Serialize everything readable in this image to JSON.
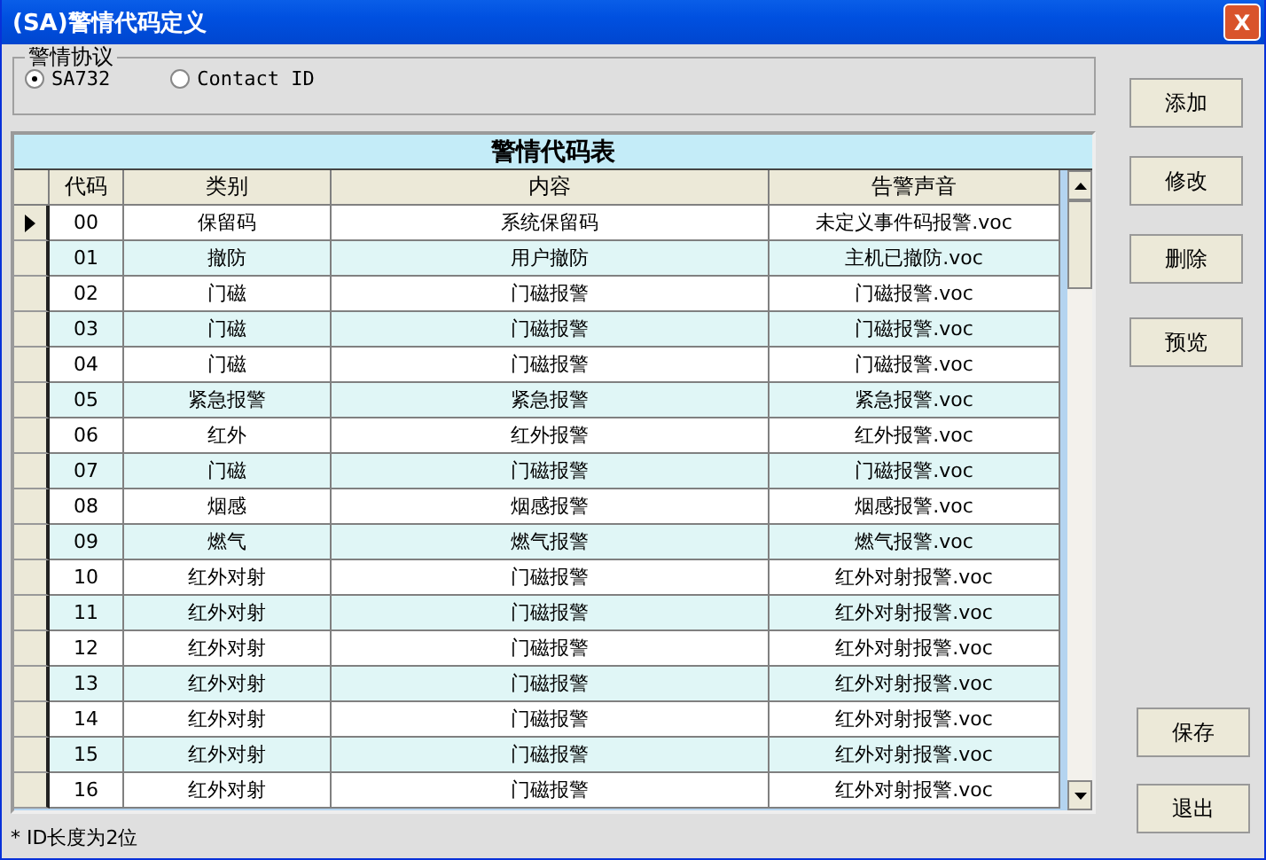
{
  "window": {
    "title": "(SA)警情代码定义",
    "close": "X"
  },
  "protocol": {
    "label": "警情协议",
    "options": [
      {
        "label": "SA732",
        "selected": true
      },
      {
        "label": "Contact ID",
        "selected": false
      }
    ]
  },
  "table": {
    "title": "警情代码表",
    "columns": [
      "代码",
      "类别",
      "内容",
      "告警声音"
    ],
    "rows": [
      {
        "code": "00",
        "category": "保留码",
        "content": "系统保留码",
        "sound": "未定义事件码报警.voc",
        "selected": true
      },
      {
        "code": "01",
        "category": "撤防",
        "content": "用户撤防",
        "sound": "主机已撤防.voc",
        "selected": false
      },
      {
        "code": "02",
        "category": "门磁",
        "content": "门磁报警",
        "sound": "门磁报警.voc",
        "selected": false
      },
      {
        "code": "03",
        "category": "门磁",
        "content": "门磁报警",
        "sound": "门磁报警.voc",
        "selected": false
      },
      {
        "code": "04",
        "category": "门磁",
        "content": "门磁报警",
        "sound": "门磁报警.voc",
        "selected": false
      },
      {
        "code": "05",
        "category": "紧急报警",
        "content": "紧急报警",
        "sound": "紧急报警.voc",
        "selected": false
      },
      {
        "code": "06",
        "category": "红外",
        "content": "红外报警",
        "sound": "红外报警.voc",
        "selected": false
      },
      {
        "code": "07",
        "category": "门磁",
        "content": "门磁报警",
        "sound": "门磁报警.voc",
        "selected": false
      },
      {
        "code": "08",
        "category": "烟感",
        "content": "烟感报警",
        "sound": "烟感报警.voc",
        "selected": false
      },
      {
        "code": "09",
        "category": "燃气",
        "content": "燃气报警",
        "sound": "燃气报警.voc",
        "selected": false
      },
      {
        "code": "10",
        "category": "红外对射",
        "content": "门磁报警",
        "sound": "红外对射报警.voc",
        "selected": false
      },
      {
        "code": "11",
        "category": "红外对射",
        "content": "门磁报警",
        "sound": "红外对射报警.voc",
        "selected": false
      },
      {
        "code": "12",
        "category": "红外对射",
        "content": "门磁报警",
        "sound": "红外对射报警.voc",
        "selected": false
      },
      {
        "code": "13",
        "category": "红外对射",
        "content": "门磁报警",
        "sound": "红外对射报警.voc",
        "selected": false
      },
      {
        "code": "14",
        "category": "红外对射",
        "content": "门磁报警",
        "sound": "红外对射报警.voc",
        "selected": false
      },
      {
        "code": "15",
        "category": "红外对射",
        "content": "门磁报警",
        "sound": "红外对射报警.voc",
        "selected": false
      },
      {
        "code": "16",
        "category": "红外对射",
        "content": "门磁报警",
        "sound": "红外对射报警.voc",
        "selected": false
      }
    ]
  },
  "actions": [
    "添加",
    "修改",
    "删除",
    "预览"
  ],
  "bottom_actions": [
    "保存",
    "退出"
  ],
  "note": "* ID长度为2位"
}
